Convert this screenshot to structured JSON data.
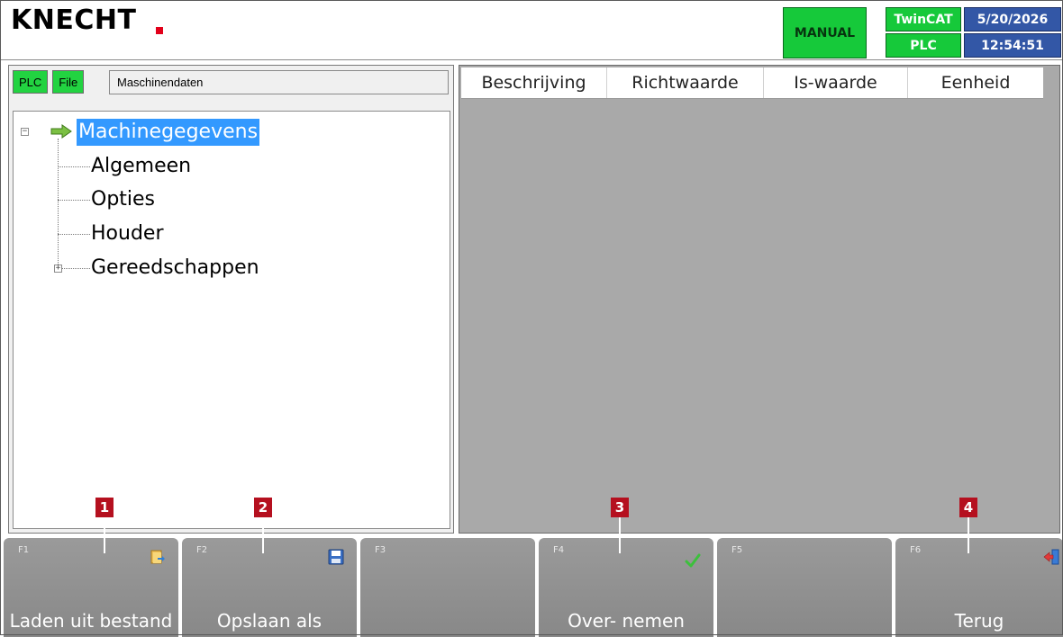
{
  "header": {
    "logo": "KNECHT",
    "mode": "MANUAL",
    "system": "TwinCAT",
    "plc_status": "PLC",
    "date": "5/20/2026",
    "time": "12:54:51"
  },
  "left": {
    "chips": [
      "PLC",
      "File"
    ],
    "path": "Maschinendaten",
    "tree": {
      "root": "Machinegegevens",
      "items": [
        "Algemeen",
        "Opties",
        "Houder",
        "Gereedschappen"
      ]
    }
  },
  "table": {
    "columns": [
      "Beschrijving",
      "Richtwaarde",
      "Is-waarde",
      "Eenheid"
    ]
  },
  "markers": [
    "1",
    "2",
    "3",
    "4"
  ],
  "fkeys": [
    {
      "key": "F1",
      "label": "Laden uit bestand",
      "icon": "folder-load-icon"
    },
    {
      "key": "F2",
      "label": "Opslaan als",
      "icon": "save-disk-icon"
    },
    {
      "key": "F3",
      "label": "",
      "icon": ""
    },
    {
      "key": "F4",
      "label": "Over- nemen",
      "icon": "checkmark-icon"
    },
    {
      "key": "F5",
      "label": "",
      "icon": ""
    },
    {
      "key": "F6",
      "label": "Terug",
      "icon": "exit-door-icon"
    }
  ],
  "colors": {
    "status_green": "#16c93a",
    "clock_blue": "#3357a6",
    "selection_blue": "#3399ff",
    "marker_red": "#b5101f",
    "key_gray": "#909090"
  }
}
